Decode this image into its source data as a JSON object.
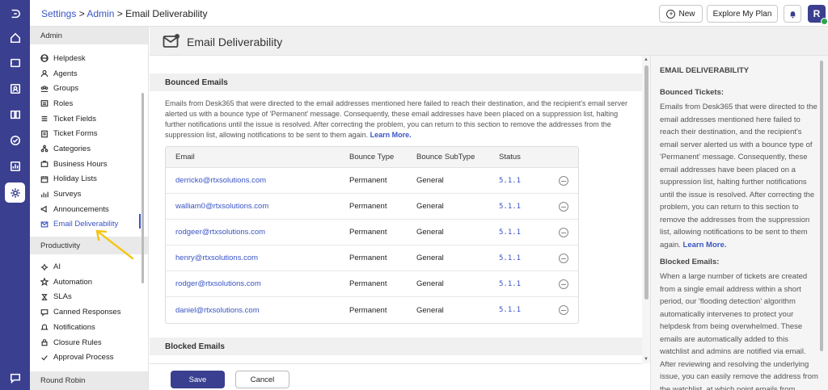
{
  "breadcrumb": {
    "settings": "Settings",
    "admin": "Admin",
    "sep": " > ",
    "current": "Email Deliverability"
  },
  "topbar": {
    "new_label": "New",
    "plan_label": "Explore My Plan",
    "avatar_letter": "R"
  },
  "sidebar": {
    "admin_head": "Admin",
    "admin_items": [
      {
        "label": "Helpdesk",
        "icon": "globe-icon"
      },
      {
        "label": "Agents",
        "icon": "person-icon"
      },
      {
        "label": "Groups",
        "icon": "people-icon"
      },
      {
        "label": "Roles",
        "icon": "roles-icon"
      },
      {
        "label": "Ticket Fields",
        "icon": "list-icon"
      },
      {
        "label": "Ticket Forms",
        "icon": "form-icon"
      },
      {
        "label": "Categories",
        "icon": "categories-icon"
      },
      {
        "label": "Business Hours",
        "icon": "briefcase-icon"
      },
      {
        "label": "Holiday Lists",
        "icon": "calendar-icon"
      },
      {
        "label": "Surveys",
        "icon": "survey-icon"
      },
      {
        "label": "Announcements",
        "icon": "megaphone-icon"
      },
      {
        "label": "Email Deliverability",
        "icon": "mail-icon"
      }
    ],
    "productivity_head": "Productivity",
    "productivity_items": [
      {
        "label": "AI",
        "icon": "ai-icon"
      },
      {
        "label": "Automation",
        "icon": "automation-icon"
      },
      {
        "label": "SLAs",
        "icon": "sla-icon"
      },
      {
        "label": "Canned Responses",
        "icon": "canned-icon"
      },
      {
        "label": "Notifications",
        "icon": "bell-icon"
      },
      {
        "label": "Closure Rules",
        "icon": "closure-icon"
      },
      {
        "label": "Approval Process",
        "icon": "approval-icon"
      }
    ],
    "round_robin_head": "Round Robin"
  },
  "page": {
    "title": "Email Deliverability"
  },
  "bounced": {
    "head": "Bounced Emails",
    "description": "Emails from Desk365 that were directed to the email addresses mentioned here failed to reach their destination, and the recipient's email server alerted us with a bounce type of 'Permanent' message. Consequently, these email addresses have been placed on a suppression list, halting further notifications until the issue is resolved. After correcting the problem, you can return to this section to remove the addresses from the suppression list, allowing notifications to be sent to them again.",
    "learn_more": "Learn More.",
    "columns": [
      "Email",
      "Bounce Type",
      "Bounce SubType",
      "Status"
    ],
    "rows": [
      {
        "email": "derricko@rtxsolutions.com",
        "type": "Permanent",
        "subtype": "General",
        "status": "5.1.1"
      },
      {
        "email": "walliam0@rtxsolutions.com",
        "type": "Permanent",
        "subtype": "General",
        "status": "5.1.1"
      },
      {
        "email": "rodgeer@rtxsolutions.com",
        "type": "Permanent",
        "subtype": "General",
        "status": "5.1.1"
      },
      {
        "email": "henry@rtxsolutions.com",
        "type": "Permanent",
        "subtype": "General",
        "status": "5.1.1"
      },
      {
        "email": "rodger@rtxsolutions.com",
        "type": "Permanent",
        "subtype": "General",
        "status": "5.1.1"
      },
      {
        "email": "daniel@rtxsolutions.com",
        "type": "Permanent",
        "subtype": "General",
        "status": "5.1.1"
      }
    ]
  },
  "blocked": {
    "head": "Blocked Emails"
  },
  "footer": {
    "save_label": "Save",
    "cancel_label": "Cancel"
  },
  "help": {
    "title": "EMAIL DELIVERABILITY",
    "bounced_sub": "Bounced Tickets:",
    "bounced_text": "Emails from Desk365 that were directed to the email addresses mentioned here failed to reach their destination, and the recipient's email server alerted us with a bounce type of 'Permanent' message. Consequently, these email addresses have been placed on a suppression list, halting further notifications until the issue is resolved. After correcting the problem, you can return to this section to remove the addresses from the suppression list, allowing notifications to be sent to them again.",
    "learn_more": "Learn More.",
    "blocked_sub": "Blocked Emails:",
    "blocked_text": "When a large number of tickets are created from a single email address within a short period, our 'flooding detection' algorithm automatically intervenes to protect your helpdesk from being overwhelmed. These emails are automatically added to this watchlist and admins are notified via email. After reviewing and resolving the underlying issue, you can easily remove the address from the watchlist, at which point emails from"
  },
  "colors": {
    "accent": "#3a3f8f",
    "link": "#3a54c4",
    "annotation_arrow": "#f5c518"
  }
}
